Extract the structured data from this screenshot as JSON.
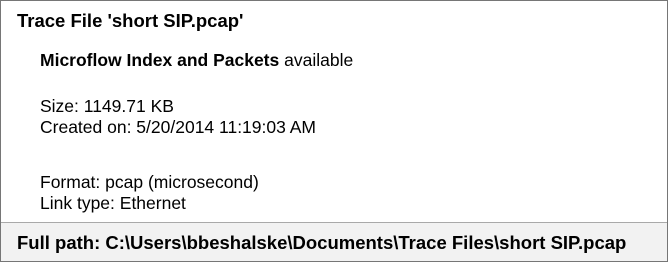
{
  "tooltip": {
    "title": "Trace File 'short SIP.pcap'",
    "availability": {
      "bold_text": "Microflow Index and Packets",
      "status": "available"
    },
    "size": "Size: 1149.71 KB",
    "created": "Created on: 5/20/2014 11:19:03 AM",
    "format": "Format: pcap (microsecond)",
    "link_type": "Link type: Ethernet",
    "full_path": "Full path: C:\\Users\\bbeshalske\\Documents\\Trace Files\\short SIP.pcap"
  }
}
